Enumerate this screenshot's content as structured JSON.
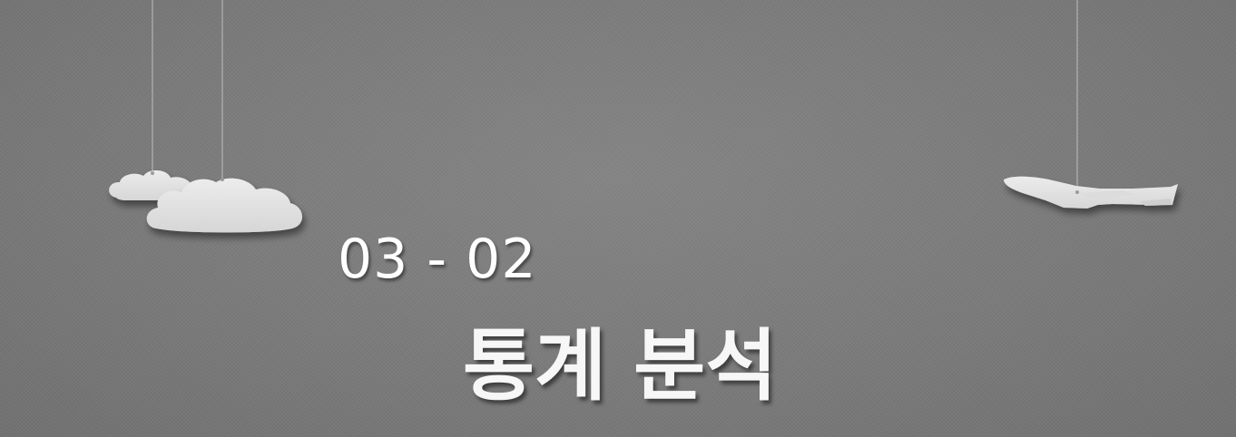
{
  "slide": {
    "section_number": "03 - 02",
    "section_title": "통계 분석"
  },
  "decorations": {
    "left": "hanging-clouds",
    "right": "hanging-airplane"
  },
  "colors": {
    "background": "#7c7c7c",
    "text": "#ffffff",
    "paper": "#e6e6e6"
  }
}
